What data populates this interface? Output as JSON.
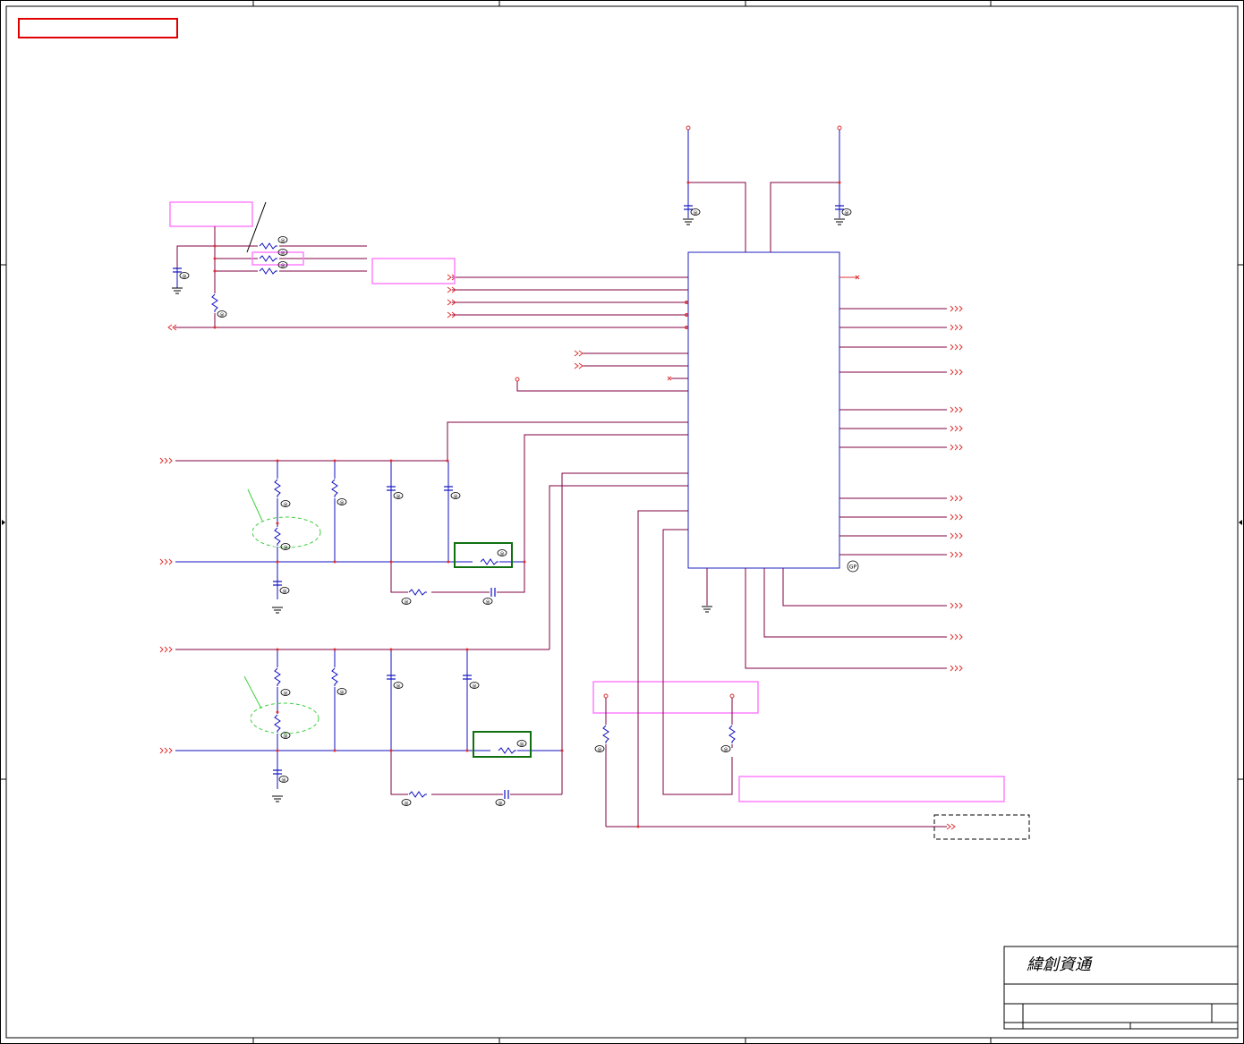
{
  "title_block": {
    "company": "緯創資通"
  },
  "colors": {
    "wire": "#800040",
    "net_arrow": "#e03030",
    "component": "#1010c0",
    "ic_outline": "#2020c0",
    "note_box": "#ff80ff",
    "warning_box": "#e00000",
    "highlight_box": "#107010",
    "annotation_green": "#40d040",
    "frame": "#000000"
  }
}
